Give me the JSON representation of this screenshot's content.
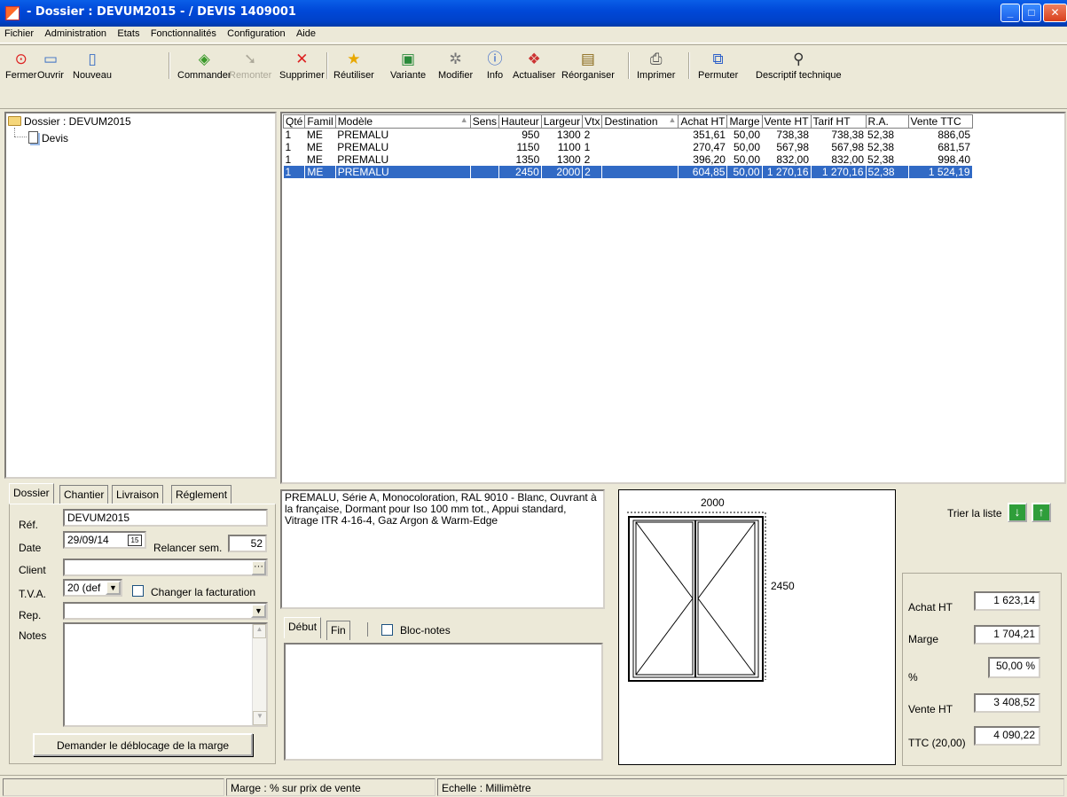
{
  "window": {
    "title": " - Dossier : DEVUM2015 -  / DEVIS  1409001"
  },
  "menu": [
    "Fichier",
    "Administration",
    "Etats",
    "Fonctionnalités",
    "Configuration",
    "Aide"
  ],
  "menu_underline": [
    "F",
    "d",
    "E",
    "o",
    "C",
    "A"
  ],
  "toolbar": {
    "fermer": "Fermer",
    "ouvrir": "Ouvrir",
    "nouveau": "Nouveau",
    "commander": "Commander",
    "remonter": "Remonter",
    "supprimer": "Supprimer",
    "reutiliser": "Réutiliser",
    "variante": "Variante",
    "modifier": "Modifier",
    "info": "Info",
    "actualiser": "Actualiser",
    "reorganiser": "Réorganiser",
    "imprimer": "Imprimer",
    "permuter": "Permuter",
    "descriptif": "Descriptif technique"
  },
  "tree": {
    "root": "Dossier : DEVUM2015",
    "child": "Devis"
  },
  "grid": {
    "headers": [
      "Qté",
      "Famil",
      "Modèle",
      "Sens",
      "Hauteur",
      "Largeur",
      "Vtx",
      "Destination",
      "Achat HT",
      "Marge",
      "Vente HT",
      "Tarif HT",
      "R.A.",
      "Vente TTC"
    ],
    "rows": [
      [
        "1",
        "ME",
        "PREMALU",
        "",
        "950",
        "1300",
        "2",
        "",
        "351,61",
        "50,00",
        "738,38",
        "738,38",
        "52,38",
        "886,05"
      ],
      [
        "1",
        "ME",
        "PREMALU",
        "",
        "1150",
        "1100",
        "1",
        "",
        "270,47",
        "50,00",
        "567,98",
        "567,98",
        "52,38",
        "681,57"
      ],
      [
        "1",
        "ME",
        "PREMALU",
        "",
        "1350",
        "1300",
        "2",
        "",
        "396,20",
        "50,00",
        "832,00",
        "832,00",
        "52,38",
        "998,40"
      ],
      [
        "1",
        "ME",
        "PREMALU",
        "",
        "2450",
        "2000",
        "2",
        "",
        "604,85",
        "50,00",
        "1 270,16",
        "1 270,16",
        "52,38",
        "1 524,19"
      ]
    ],
    "selected_row": 3
  },
  "left_tabs": [
    "Dossier",
    "Chantier",
    "Livraison",
    "Réglement"
  ],
  "form": {
    "ref_label": "Réf.",
    "ref_value": "DEVUM2015",
    "date_label": "Date",
    "date_value": "29/09/14",
    "cal_icon": "15",
    "relancer_label": "Relancer sem.",
    "relancer_value": "52",
    "client_label": "Client",
    "client_value": "",
    "client_btn": "···",
    "tva_label": "T.V.A.",
    "tva_value": "20 (def",
    "changer_label": "Changer la facturation",
    "rep_label": "Rep.",
    "rep_value": "",
    "notes_label": "Notes",
    "deblocage_button": "Demander le déblocage de la marge"
  },
  "description": "PREMALU, Série A,  Monocoloration,  RAL 9010 - Blanc, Ouvrant à la française, Dormant pour Iso 100 mm tot.,  Appui standard, Vitrage ITR 4-16-4, Gaz Argon & Warm-Edge",
  "mid_tabs": {
    "debut": "Début",
    "fin": "Fin",
    "bloc_notes": "Bloc-notes"
  },
  "drawing": {
    "width_label": "2000",
    "height_label": "2450"
  },
  "sort": {
    "label": "Trier la liste",
    "down_icon": "arrow-down-icon",
    "up_icon": "arrow-up-icon"
  },
  "totals": {
    "achat_label": "Achat HT",
    "achat_value": "1 623,14",
    "marge_label": "Marge",
    "marge_value": "1 704,21",
    "pct_label": "%",
    "pct_value": "50,00 %",
    "vente_label": "Vente HT",
    "vente_value": "3 408,52",
    "ttc_label": "TTC (20,00)",
    "ttc_value": "4 090,22"
  },
  "status": {
    "marge": "Marge : % sur prix de vente",
    "echelle": "Echelle : Millimètre"
  }
}
